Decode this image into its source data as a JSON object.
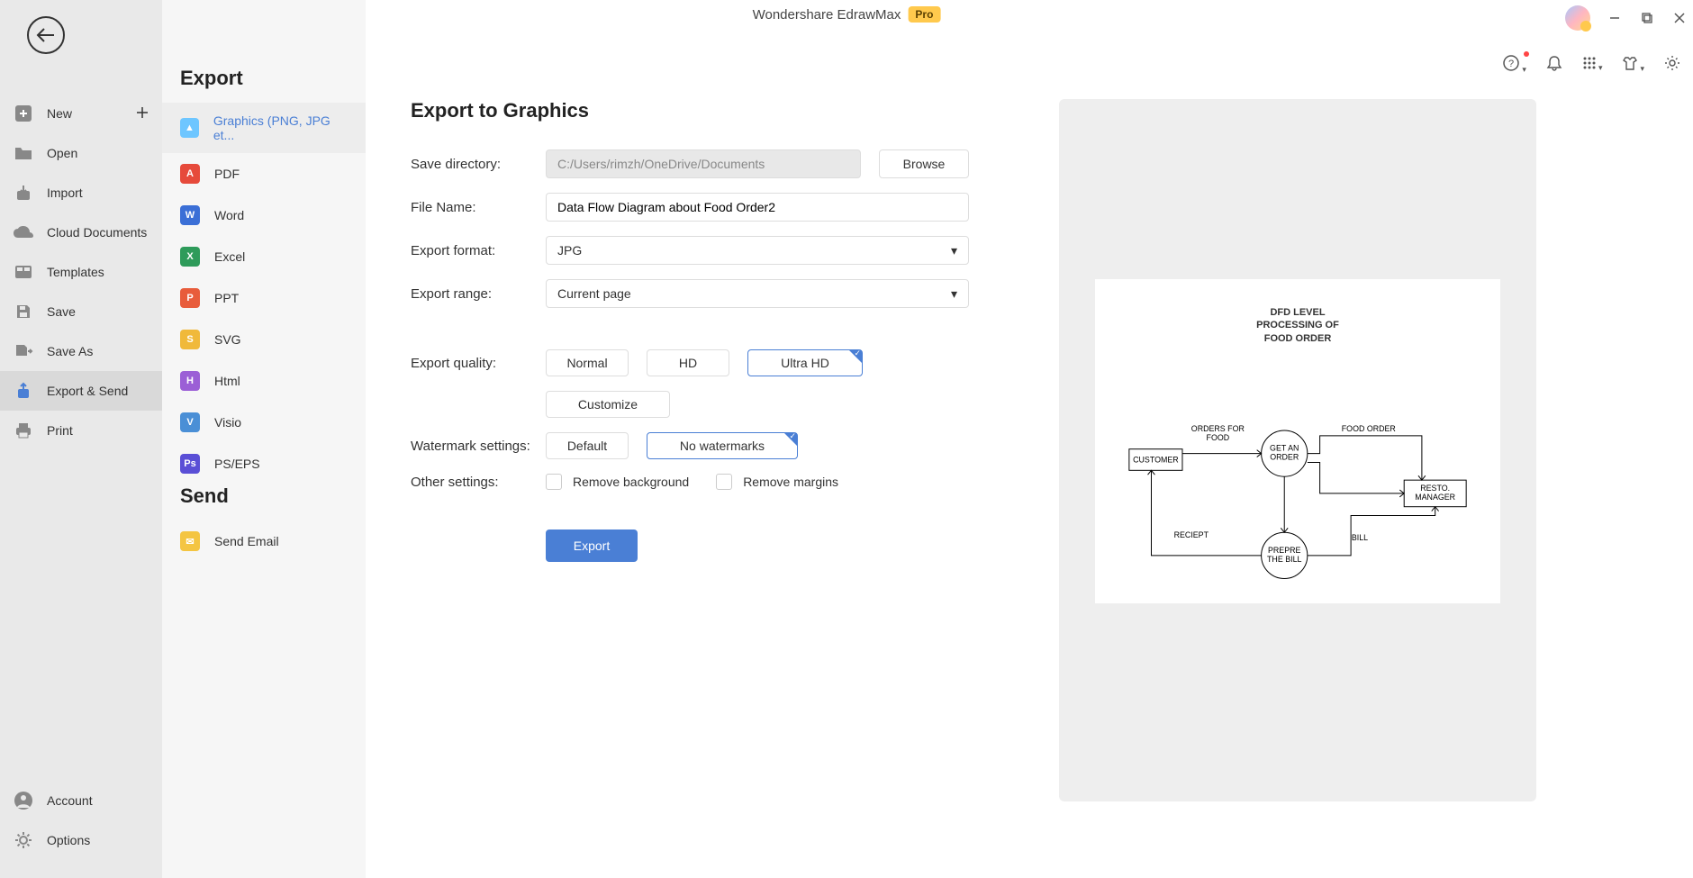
{
  "titlebar": {
    "app_name": "Wondershare EdrawMax",
    "badge": "Pro"
  },
  "col1": {
    "items": [
      {
        "label": "New",
        "has_plus": true
      },
      {
        "label": "Open"
      },
      {
        "label": "Import"
      },
      {
        "label": "Cloud Documents"
      },
      {
        "label": "Templates"
      },
      {
        "label": "Save"
      },
      {
        "label": "Save As"
      },
      {
        "label": "Export & Send",
        "active": true
      },
      {
        "label": "Print"
      }
    ],
    "bottom": [
      {
        "label": "Account"
      },
      {
        "label": "Options"
      }
    ]
  },
  "col2": {
    "export_heading": "Export",
    "formats": [
      {
        "label": "Graphics (PNG, JPG et...",
        "color": "#6ec6ff",
        "active": true
      },
      {
        "label": "PDF",
        "color": "#e64a3b"
      },
      {
        "label": "Word",
        "color": "#3b6fd6"
      },
      {
        "label": "Excel",
        "color": "#2e9b5a"
      },
      {
        "label": "PPT",
        "color": "#e85c3b"
      },
      {
        "label": "SVG",
        "color": "#f0b93a"
      },
      {
        "label": "Html",
        "color": "#9b5fd6"
      },
      {
        "label": "Visio",
        "color": "#4a8fd6"
      },
      {
        "label": "PS/EPS",
        "color": "#5a4fd6"
      }
    ],
    "send_heading": "Send",
    "send_items": [
      {
        "label": "Send Email",
        "color": "#f4c542"
      }
    ]
  },
  "main": {
    "heading": "Export to Graphics",
    "labels": {
      "save_dir": "Save directory:",
      "file_name": "File Name:",
      "format": "Export format:",
      "range": "Export range:",
      "quality": "Export quality:",
      "watermark": "Watermark settings:",
      "other": "Other settings:"
    },
    "values": {
      "save_dir": "C:/Users/rimzh/OneDrive/Documents",
      "file_name": "Data Flow Diagram about Food Order2",
      "format": "JPG",
      "range": "Current page"
    },
    "buttons": {
      "browse": "Browse",
      "normal": "Normal",
      "hd": "HD",
      "ultra": "Ultra HD",
      "customize": "Customize",
      "default": "Default",
      "nowm": "No watermarks",
      "remove_bg": "Remove background",
      "remove_margins": "Remove margins",
      "export": "Export"
    }
  },
  "preview": {
    "title_l1": "DFD LEVEL",
    "title_l2": "PROCESSING OF",
    "title_l3": "FOOD ORDER",
    "labels": {
      "orders_for_food": "ORDERS FOR\nFOOD",
      "food_order": "FOOD ORDER",
      "customer": "CUSTOMER",
      "get_order": "GET AN\nORDER",
      "resto_manager": "RESTO.\nMANAGER",
      "receipt": "RECIEPT",
      "bill": "BILL",
      "prepare_bill": "PREPRE\nTHE BILL"
    }
  }
}
